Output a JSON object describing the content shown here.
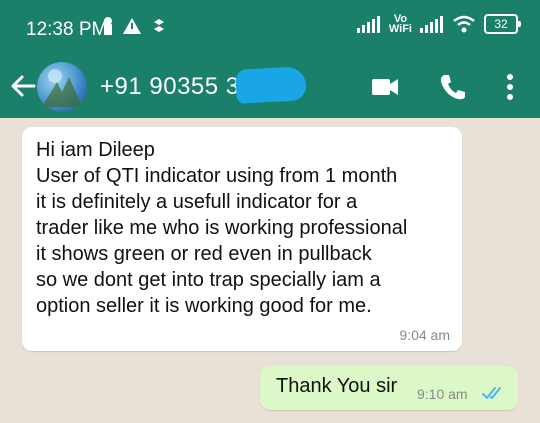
{
  "status_bar": {
    "time": "12:38 PM",
    "network_label": "Vo\nWiFi",
    "battery": "32"
  },
  "header": {
    "contact": "+91 90355 3",
    "icons": [
      "back-arrow-icon",
      "video-call-icon",
      "phone-icon",
      "more-vertical-icon"
    ]
  },
  "messages": [
    {
      "direction": "incoming",
      "text": "Hi iam Dileep\nUser of QTI indicator using from 1 month\nit is definitely a usefull indicator for a\ntrader like me who is working professional\nit shows green or red even in pullback\nso we dont get into trap specially iam a\noption seller it is working good for me.",
      "time": "9:04 am"
    },
    {
      "direction": "outgoing",
      "text": "Thank You sir",
      "time": "9:10 am",
      "status": "read"
    }
  ],
  "colors": {
    "header": "#1b8069",
    "chat_bg": "#e9e1d7",
    "outgoing_bubble": "#dcf8c6",
    "read_ticks": "#4fb3f0"
  }
}
